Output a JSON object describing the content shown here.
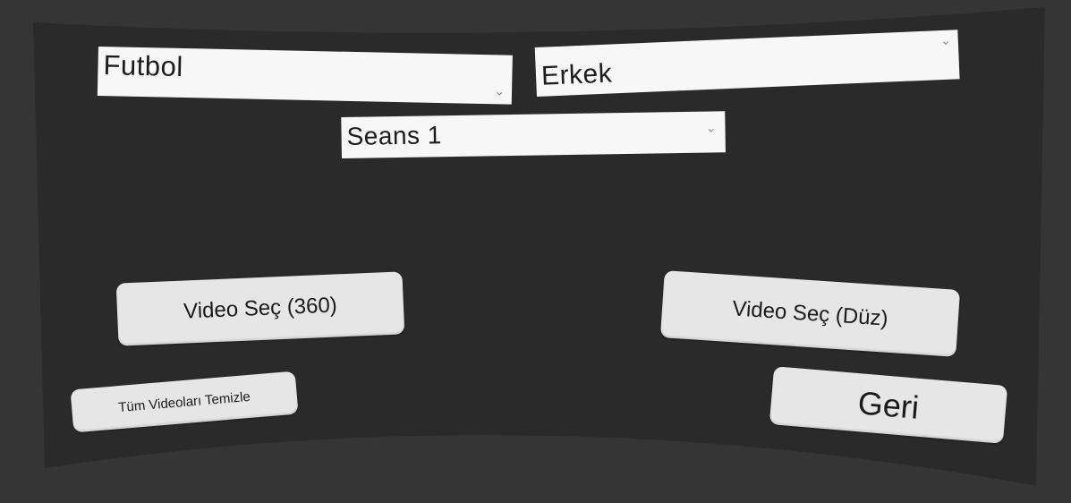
{
  "dropdowns": {
    "sport": {
      "value": "Futbol"
    },
    "gender": {
      "value": "Erkek"
    },
    "session": {
      "value": "Seans 1"
    }
  },
  "buttons": {
    "video_360": "Video Seç (360)",
    "video_flat": "Video Seç (Düz)",
    "clear_all": "Tüm Videoları Temizle",
    "back": "Geri"
  },
  "icons": {
    "dropdown_arrow": "chevron-down-icon"
  },
  "colors": {
    "background": "#353535",
    "panel": "#2a2a2a",
    "dropdown": "#f7f7f7",
    "button": "#e6e6e6",
    "text": "#1a1a1a"
  }
}
